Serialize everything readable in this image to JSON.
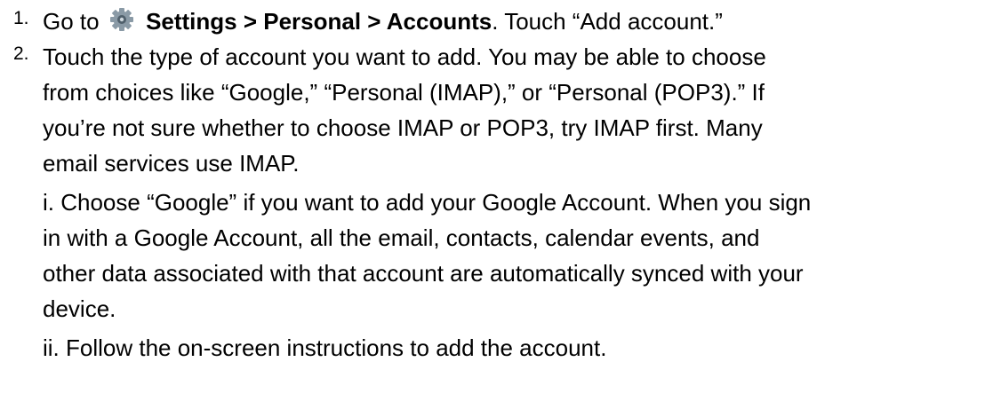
{
  "steps": [
    {
      "number": "1.",
      "prefix": "Go to",
      "icon": "settings-gear-icon",
      "path": "Settings > Personal > Accounts",
      "suffix": ". Touch “Add account.”"
    },
    {
      "number": "2.",
      "lines": [
        "Touch the type of account you want to add. You may be able to choose",
        "from choices like “Google,” “Personal (IMAP),” or “Personal (POP3).” If",
        "you’re not sure whether to choose IMAP or POP3, try IMAP first. Many",
        "email services use IMAP."
      ],
      "sub_i": [
        "i. Choose “Google” if you want to add your Google Account. When you sign",
        "in with a Google Account, all the email, contacts, calendar events, and",
        "other data associated with that account are automatically synced with your",
        "device."
      ],
      "sub_ii": "ii. Follow the on-screen instructions to add the account."
    }
  ],
  "colors": {
    "text": "#000000",
    "background": "#ffffff",
    "icon_gear": "#8a9aa6",
    "icon_gear_dark": "#4f5f6b"
  }
}
